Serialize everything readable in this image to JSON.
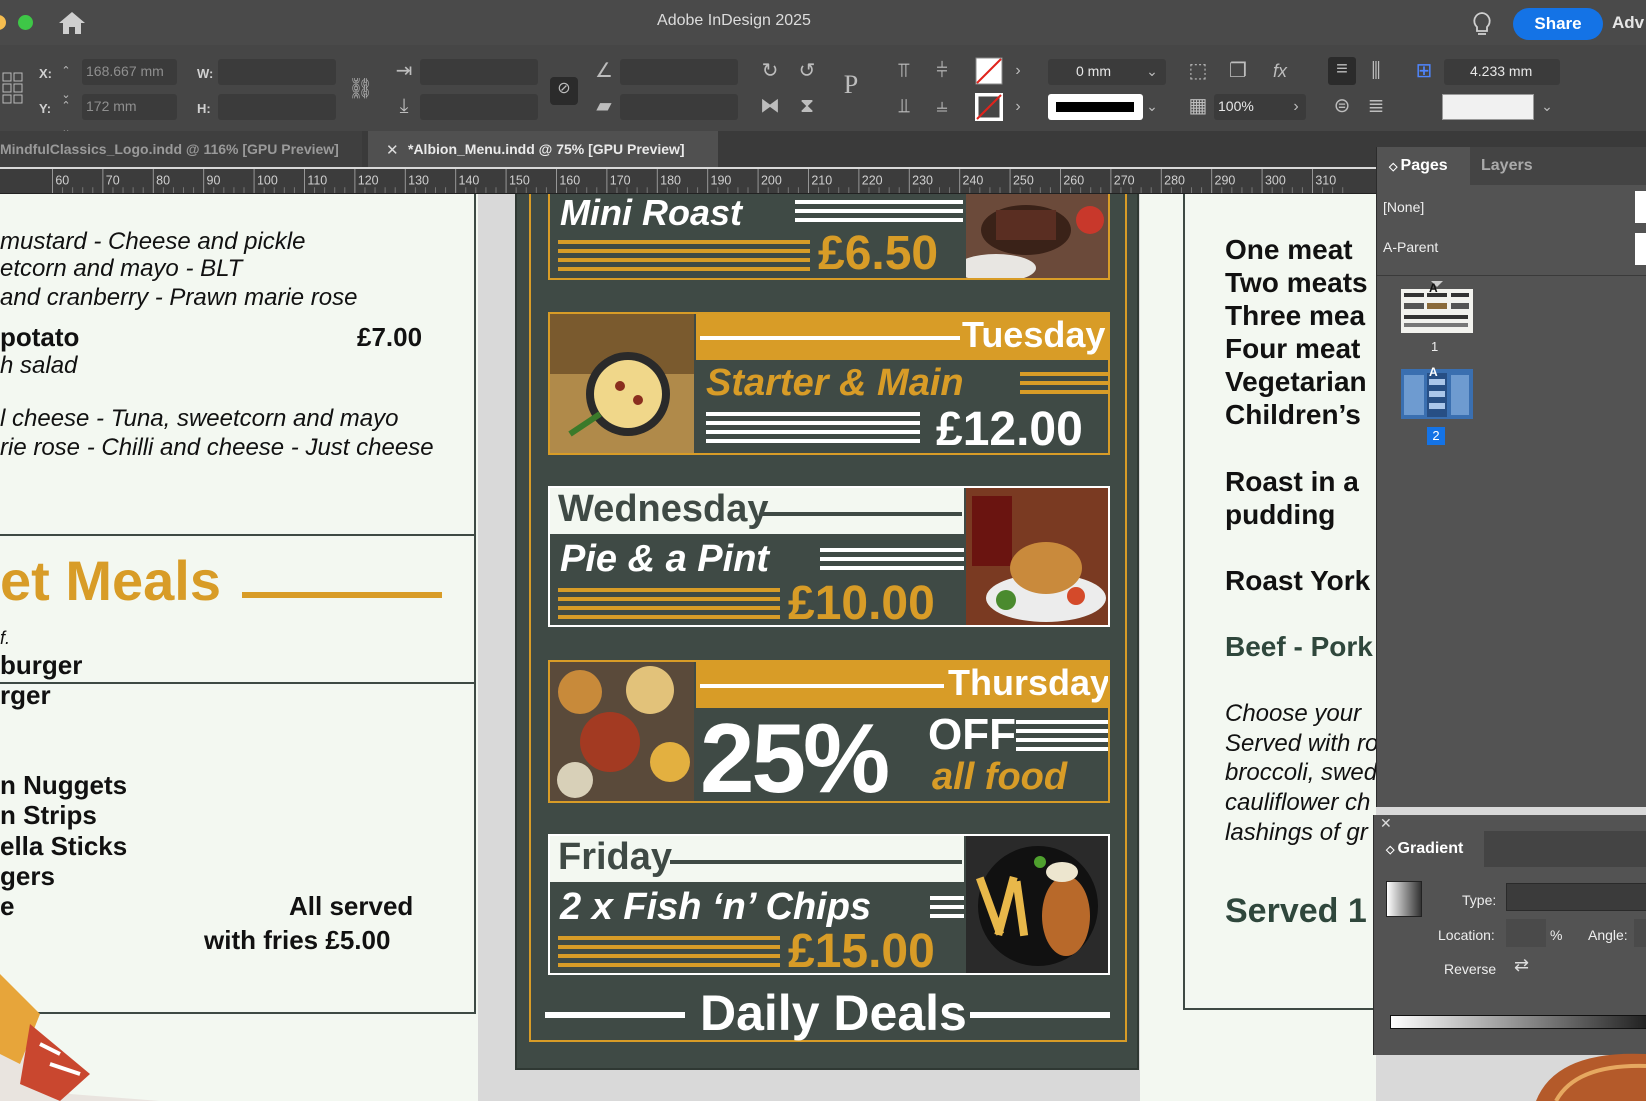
{
  "window": {
    "title": "Adobe InDesign 2025",
    "share_label": "Share",
    "adv_label": "Adv"
  },
  "control": {
    "x_label": "X:",
    "x_value": "168.667 mm",
    "y_label": "Y:",
    "y_value": "172 mm",
    "w_label": "W:",
    "h_label": "H:",
    "stroke_weight": "0 mm",
    "opacity": "100%",
    "spacing": "4.233 mm"
  },
  "tabs": [
    {
      "label": "MindfulClassics_Logo.indd @ 116% [GPU Preview]"
    },
    {
      "label": "*Albion_Menu.indd @ 75% [GPU Preview]"
    }
  ],
  "ruler": [
    "60",
    "70",
    "80",
    "90",
    "100",
    "110",
    "120",
    "130",
    "140",
    "150",
    "160",
    "170",
    "180",
    "190",
    "200",
    "210",
    "220",
    "230",
    "240",
    "250",
    "260",
    "270",
    "280",
    "290",
    "300",
    "310"
  ],
  "left_page": {
    "lines": [
      "mustard - Cheese and pickle",
      "etcorn and mayo - BLT",
      "and cranberry - Prawn marie rose",
      "potato",
      "£7.00",
      "h salad",
      "l cheese - Tuna, sweetcorn and mayo",
      "rie rose - Chilli and cheese - Just cheese"
    ],
    "meals_heading": "et Meals",
    "meals_sub": "f.",
    "items": [
      "burger",
      "rger",
      "n Nuggets",
      "n Strips",
      "ella Sticks",
      "gers",
      "e"
    ],
    "served_1": "All served",
    "served_2": "with fries £5.00"
  },
  "deals": {
    "monday": {
      "title": "Mini Roast",
      "price": "£6.50"
    },
    "tuesday": {
      "day": "Tuesday",
      "title": "Starter & Main",
      "price": "£12.00"
    },
    "wednesday": {
      "day": "Wednesday",
      "title": "Pie & a Pint",
      "price": "£10.00"
    },
    "thursday": {
      "day": "Thursday",
      "pct": "25%",
      "off": "OFF",
      "sub": "all food"
    },
    "friday": {
      "day": "Friday",
      "title": "2 x Fish ‘n’ Chips",
      "price": "£15.00"
    },
    "footer": "Daily Deals"
  },
  "right_page": {
    "lines": [
      "One meat",
      "Two meats",
      "Three mea",
      "Four meat",
      "Vegetarian",
      "Children’s"
    ],
    "roast_1": "Roast in a",
    "roast_2": "pudding",
    "roast_york": "Roast York",
    "beef": "Beef - Pork",
    "italic": [
      "Choose your",
      "Served with ro",
      "broccoli, swed",
      "cauliflower ch",
      "lashings of gr"
    ],
    "served": "Served 1"
  },
  "pages_panel": {
    "tab_pages": "Pages",
    "tab_layers": "Layers",
    "none": "[None]",
    "parent": "A-Parent",
    "page1": "1",
    "page2": "2",
    "thumb_letter": "A"
  },
  "gradient_panel": {
    "title": "Gradient",
    "type_label": "Type:",
    "location_label": "Location:",
    "pct": "%",
    "angle_label": "Angle:",
    "reverse_label": "Reverse"
  },
  "colors": {
    "gold": "#d89c27",
    "board": "#3f4a45",
    "cream": "#f3f8f1",
    "accent": "#1473e6"
  }
}
